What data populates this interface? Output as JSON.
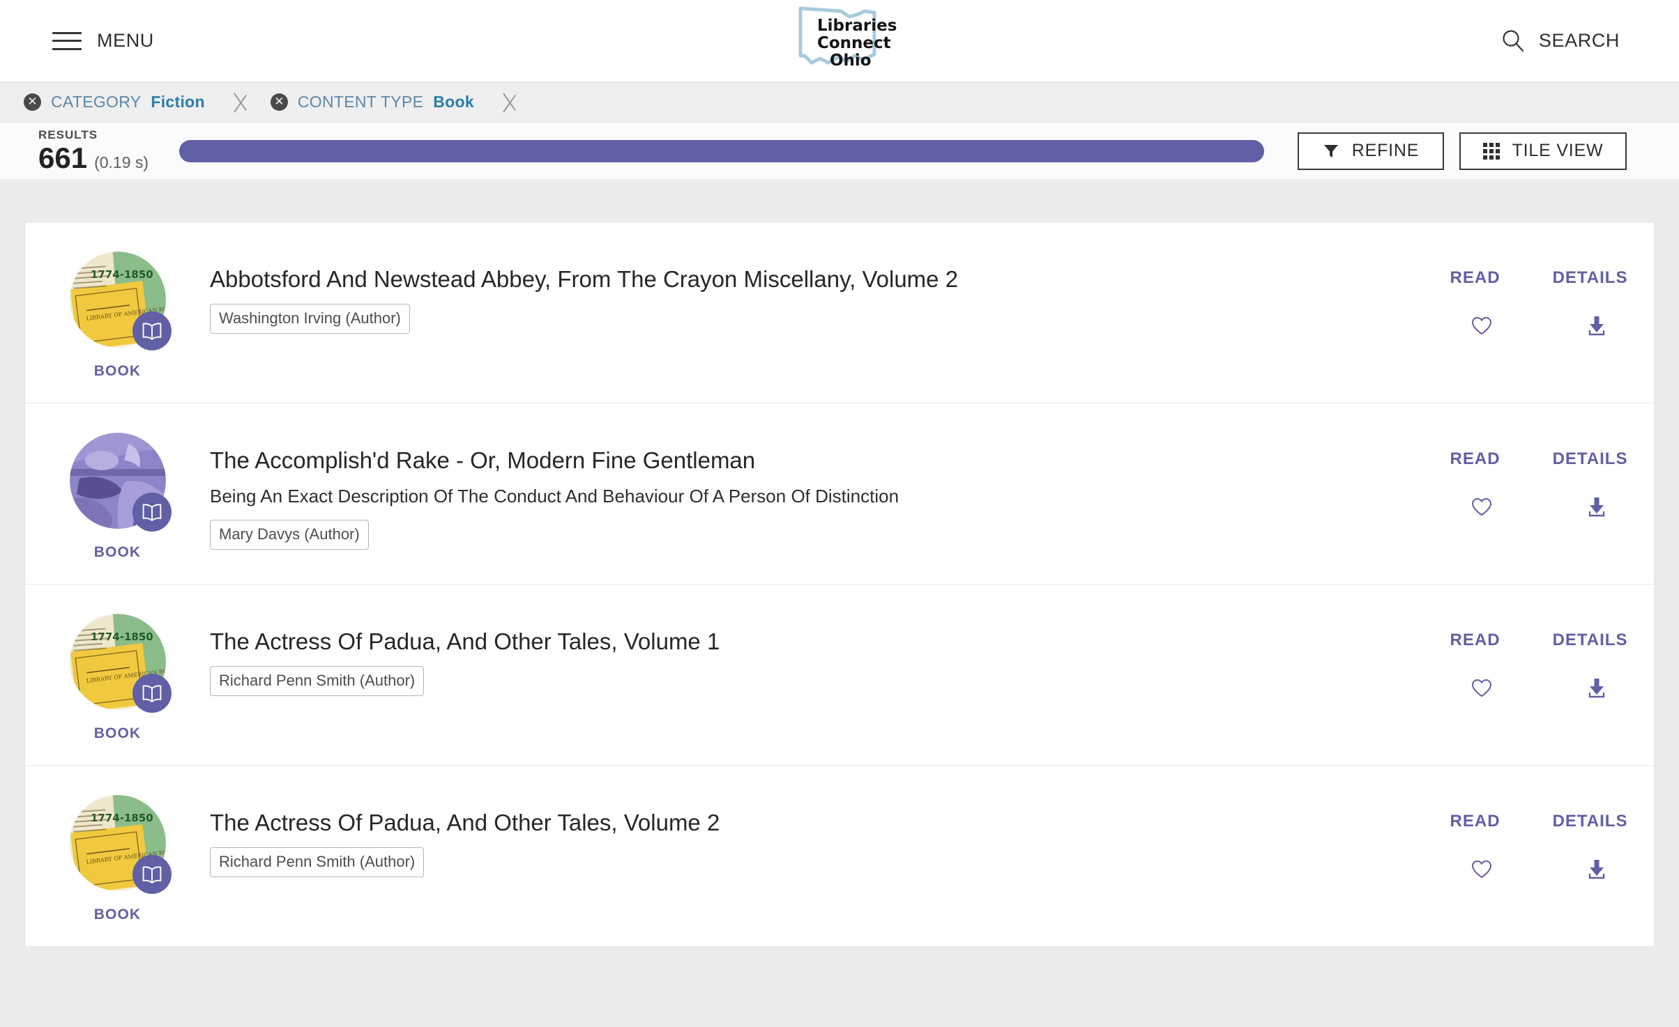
{
  "header": {
    "menu_label": "MENU",
    "menu_icon": "hamburger-icon",
    "search_label": "SEARCH",
    "search_icon": "search-icon",
    "logo": {
      "line1": "Libraries",
      "line2": "Connect",
      "line3": "Ohio",
      "outline_color": "#a8cbdc",
      "text_color": "#1b1b1b"
    }
  },
  "filters": {
    "chips": [
      {
        "remove_icon": "close-circle-icon",
        "key": "CATEGORY",
        "value": "Fiction"
      },
      {
        "remove_icon": "close-circle-icon",
        "key": "CONTENT TYPE",
        "value": "Book"
      }
    ]
  },
  "results_bar": {
    "label": "RESULTS",
    "count": "661",
    "time": "(0.19 s)",
    "progress_percent": 100,
    "progress_color": "#615fa5",
    "refine_button": {
      "label": "REFINE",
      "icon": "filter-funnel-icon"
    },
    "tile_view_button": {
      "label": "TILE VIEW",
      "icon": "grid-tiles-icon"
    }
  },
  "results": [
    {
      "title": "Abbotsford And Newstead Abbey, From The Crayon Miscellany, Volume 2",
      "subtitle": "",
      "author": "Washington Irving (Author)",
      "type_label": "BOOK",
      "type_icon": "open-book-icon",
      "thumb_style": "vintage-books",
      "read_label": "READ",
      "details_label": "DETAILS",
      "favorite_icon": "heart-icon",
      "download_icon": "download-icon"
    },
    {
      "title": "The Accomplish'd Rake - Or, Modern Fine Gentleman",
      "subtitle": "Being An Exact Description Of The Conduct And Behaviour Of A Person Of Distinction",
      "author": "Mary Davys (Author)",
      "type_label": "BOOK",
      "type_icon": "open-book-icon",
      "thumb_style": "purple-illustration",
      "read_label": "READ",
      "details_label": "DETAILS",
      "favorite_icon": "heart-icon",
      "download_icon": "download-icon"
    },
    {
      "title": "The Actress Of Padua, And Other Tales, Volume 1",
      "subtitle": "",
      "author": "Richard Penn Smith (Author)",
      "type_label": "BOOK",
      "type_icon": "open-book-icon",
      "thumb_style": "vintage-books",
      "read_label": "READ",
      "details_label": "DETAILS",
      "favorite_icon": "heart-icon",
      "download_icon": "download-icon"
    },
    {
      "title": "The Actress Of Padua, And Other Tales, Volume 2",
      "subtitle": "",
      "author": "Richard Penn Smith (Author)",
      "type_label": "BOOK",
      "type_icon": "open-book-icon",
      "thumb_style": "vintage-books",
      "read_label": "READ",
      "details_label": "DETAILS",
      "favorite_icon": "heart-icon",
      "download_icon": "download-icon"
    }
  ],
  "theme": {
    "accent_purple": "#615fa5",
    "link_blue": "#2b7dac",
    "muted_blue": "#5b88a8",
    "page_bg": "#ececec",
    "card_bg": "#ffffff"
  }
}
